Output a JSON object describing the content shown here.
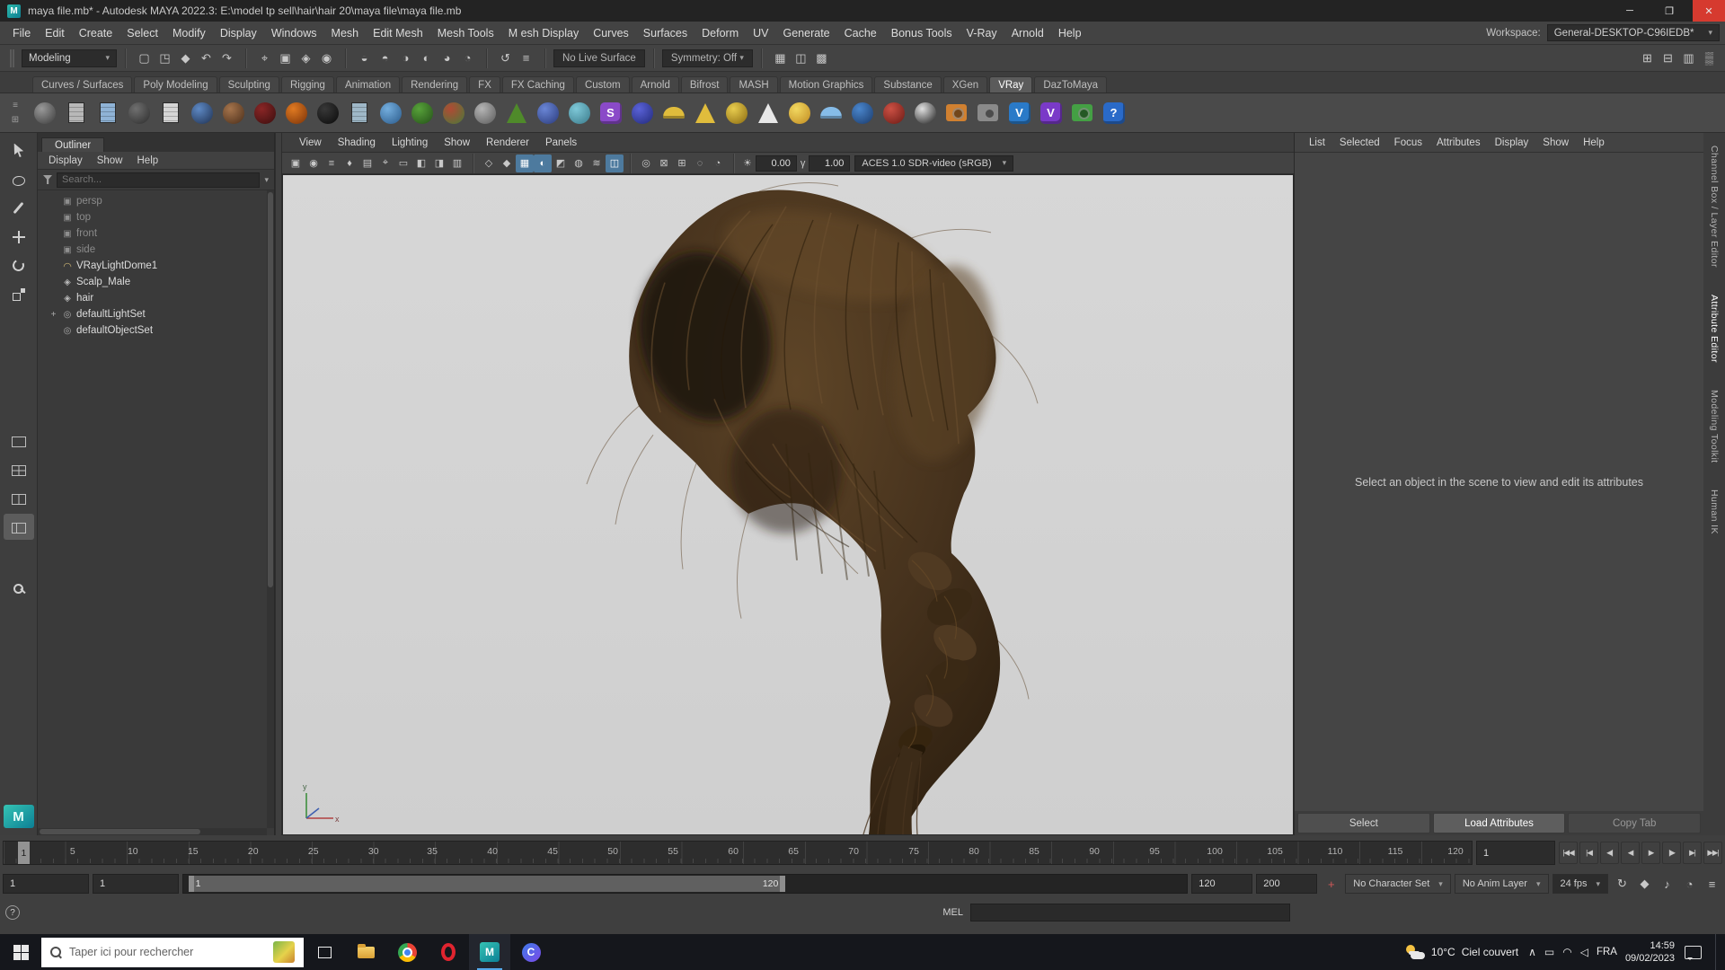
{
  "ui": {
    "caret": "▾"
  },
  "window": {
    "app_badge": "M",
    "title": "maya file.mb* - Autodesk MAYA 2022.3: E:\\model tp sell\\hair\\hair 20\\maya file\\maya file.mb",
    "minimize": "─",
    "maximize": "❐",
    "close": "✕"
  },
  "menubar": {
    "items": [
      "File",
      "Edit",
      "Create",
      "Select",
      "Modify",
      "Display",
      "Windows",
      "Mesh",
      "Edit Mesh",
      "Mesh Tools",
      "M esh Display",
      "Curves",
      "Surfaces",
      "Deform",
      "UV",
      "Generate",
      "Cache",
      "Bonus Tools",
      "V-Ray",
      "Arnold",
      "Help"
    ],
    "workspace_label": "Workspace:",
    "workspace_value": "General-DESKTOP-C96IEDB*"
  },
  "toolbar": {
    "mode": "Modeling",
    "no_live_surface": "No Live Surface",
    "symmetry": "Symmetry: Off",
    "groups": {
      "file": [
        {
          "g": "▢",
          "k": "new-scene-icon"
        },
        {
          "g": "◳",
          "k": "open-scene-icon"
        },
        {
          "g": "◆",
          "k": "save-scene-icon"
        },
        {
          "g": "↶",
          "k": "undo-icon"
        },
        {
          "g": "↷",
          "k": "redo-icon"
        }
      ],
      "select": [
        {
          "g": "⌖",
          "k": "select-by-hierarchy-icon"
        },
        {
          "g": "▣",
          "k": "select-by-object-icon"
        },
        {
          "g": "◈",
          "k": "select-by-component-icon"
        },
        {
          "g": "◉",
          "k": "highlight-selection-icon"
        }
      ],
      "snap": [
        {
          "g": "◒",
          "k": "snap-to-grids-icon"
        },
        {
          "g": "◓",
          "k": "snap-to-curves-icon"
        },
        {
          "g": "◑",
          "k": "snap-to-points-icon"
        },
        {
          "g": "◐",
          "k": "snap-to-projected-center-icon"
        },
        {
          "g": "◕",
          "k": "snap-to-view-planes-icon"
        },
        {
          "g": "◔",
          "k": "make-live-icon"
        }
      ],
      "history": [
        {
          "g": "↺",
          "k": "construction-history-icon"
        },
        {
          "g": "≡",
          "k": "list-input-operations-icon"
        }
      ],
      "render": [
        {
          "g": "▦",
          "k": "render-current-frame-icon"
        },
        {
          "g": "◫",
          "k": "ipr-render-icon"
        },
        {
          "g": "▩",
          "k": "render-settings-icon"
        }
      ],
      "right": [
        {
          "g": "⊞",
          "k": "grid-display-icon"
        },
        {
          "g": "⊟",
          "k": "layout-options-icon"
        },
        {
          "g": "▥",
          "k": "panel-options-icon"
        },
        {
          "g": "▒",
          "k": "texture-display-icon"
        }
      ]
    }
  },
  "shelf": {
    "side_icons": [
      {
        "g": "≡",
        "k": "shelf-tab-menu-icon"
      },
      {
        "g": "⊞",
        "k": "shelf-options-icon"
      }
    ],
    "tabs": [
      {
        "label": "Curves / Surfaces"
      },
      {
        "label": "Poly Modeling"
      },
      {
        "label": "Sculpting"
      },
      {
        "label": "Rigging"
      },
      {
        "label": "Animation"
      },
      {
        "label": "Rendering"
      },
      {
        "label": "FX"
      },
      {
        "label": "FX Caching"
      },
      {
        "label": "Custom"
      },
      {
        "label": "Arnold"
      },
      {
        "label": "Bifrost"
      },
      {
        "label": "MASH"
      },
      {
        "label": "Motion Graphics"
      },
      {
        "label": "Substance"
      },
      {
        "label": "XGen"
      },
      {
        "label": "VRay",
        "active": true
      },
      {
        "label": "DazToMaya"
      }
    ],
    "icons": [
      {
        "k": "vray-material-icon",
        "type": "sphere",
        "c1": "#9a9a9a",
        "c2": "#3a3a3a"
      },
      {
        "k": "vray-mtl-page-icon",
        "type": "page",
        "c1": "#b8b8b8"
      },
      {
        "k": "vray-grid-page-icon",
        "type": "page",
        "c1": "#8fb3d6"
      },
      {
        "k": "vray-blend-mtl-icon",
        "type": "sphere",
        "c1": "#707070",
        "c2": "#2c2c2c"
      },
      {
        "k": "vray-notes-icon",
        "type": "page",
        "c1": "#d6d6d6"
      },
      {
        "k": "vray-chrome-ball-icon",
        "type": "sphere",
        "c1": "#5e89c4",
        "c2": "#1e3050"
      },
      {
        "k": "vray-skin-mtl-icon",
        "type": "sphere",
        "c1": "#a5744c",
        "c2": "#4a2e1a"
      },
      {
        "k": "vray-velvet-mtl-icon",
        "type": "sphere",
        "c1": "#8a2626",
        "c2": "#3a0e0e"
      },
      {
        "k": "vray-fire-mtl-icon",
        "type": "sphere",
        "c1": "#e07a22",
        "c2": "#7a3208"
      },
      {
        "k": "vray-carpaint-mtl-icon",
        "type": "sphere",
        "c1": "#383838",
        "c2": "#0a0a0a"
      },
      {
        "k": "vray-xray-page-icon",
        "type": "page",
        "c1": "#9fb8c8"
      },
      {
        "k": "vray-water-mtl-icon",
        "type": "sphere",
        "c1": "#74aede",
        "c2": "#2a5a8a"
      },
      {
        "k": "vray-emissive-mtl-icon",
        "type": "sphere",
        "c1": "#57a23a",
        "c2": "#245018"
      },
      {
        "k": "vray-plaid-mtl-icon",
        "type": "sphere",
        "c1": "#b04a34",
        "c2": "#4a7a3a"
      },
      {
        "k": "vray-subsurface-mtl-icon",
        "type": "sphere",
        "c1": "#b5b5b5",
        "c2": "#5a5a5a"
      },
      {
        "k": "vray-fur-grass-icon",
        "type": "cone",
        "c1": "#4f8a2a"
      },
      {
        "k": "vray-scatter-icon",
        "type": "sphere",
        "c1": "#6a86d6",
        "c2": "#2a3a7a"
      },
      {
        "k": "vray-snow-icon",
        "type": "sphere",
        "c1": "#7ec8d8",
        "c2": "#3a7a8a"
      },
      {
        "k": "vray-stochastic-icon",
        "type": "letter",
        "c1": "#8a4ac8",
        "label": "S"
      },
      {
        "k": "vray-mtl-ball-icon",
        "type": "sphere",
        "c1": "#5a62d8",
        "c2": "#222a7a"
      },
      {
        "k": "vray-dome-light-icon",
        "type": "dome",
        "c1": "#e0bc3c"
      },
      {
        "k": "vray-spot-light-icon",
        "type": "cone",
        "c1": "#e0bc3c"
      },
      {
        "k": "vray-sphere-light-icon",
        "type": "sphere",
        "c1": "#e8cc4e",
        "c2": "#8a6a10"
      },
      {
        "k": "vray-ies-light-icon",
        "type": "cone",
        "c1": "#e8e8e8"
      },
      {
        "k": "vray-sun-icon",
        "type": "sphere",
        "c1": "#f2d860",
        "c2": "#c08a20"
      },
      {
        "k": "vray-sky-icon",
        "type": "dome",
        "c1": "#86bce8"
      },
      {
        "k": "vray-light-dome-icon",
        "type": "sphere",
        "c1": "#4a86cc",
        "c2": "#1a3a6a"
      },
      {
        "k": "vray-light-mesh-icon",
        "type": "sphere",
        "c1": "#cc5044",
        "c2": "#6a1a14"
      },
      {
        "k": "vray-checker-icon",
        "type": "sphere",
        "c1": "#e0e0e0",
        "c2": "#1a1a1a"
      },
      {
        "k": "vray-physical-camera-icon",
        "type": "square",
        "c1": "#d08030"
      },
      {
        "k": "vray-camera-icon",
        "type": "square",
        "c1": "#8a8a8a"
      },
      {
        "k": "vray-render-icon",
        "type": "letter",
        "c1": "#2a7ac8",
        "label": "V"
      },
      {
        "k": "vray-ipr-icon",
        "type": "letter",
        "c1": "#7a3ac8",
        "label": "V"
      },
      {
        "k": "vray-rgb-icon",
        "type": "square",
        "c1": "#44a044"
      },
      {
        "k": "vray-help-icon",
        "type": "letter",
        "c1": "#2a6ac8",
        "label": "?"
      }
    ]
  },
  "toolbox": {
    "logo": "M",
    "tools": [
      {
        "k": "select-tool"
      },
      {
        "k": "lasso-tool"
      },
      {
        "k": "paint-select-tool"
      },
      {
        "k": "move-tool"
      },
      {
        "k": "rotate-tool"
      },
      {
        "k": "scale-tool"
      }
    ],
    "layouts": [
      {
        "k": "layout-single"
      },
      {
        "k": "layout-four"
      },
      {
        "k": "layout-two"
      },
      {
        "k": "layout-outliner",
        "active": true
      }
    ],
    "zoom": [
      {
        "k": "zoom-tool"
      }
    ]
  },
  "outliner": {
    "title": "Outliner",
    "menus": [
      "Display",
      "Show",
      "Help"
    ],
    "search_placeholder": "Search...",
    "items": [
      {
        "label": "persp",
        "type": "camera",
        "dim": true,
        "exp": ""
      },
      {
        "label": "top",
        "type": "camera",
        "dim": true,
        "exp": ""
      },
      {
        "label": "front",
        "type": "camera",
        "dim": true,
        "exp": ""
      },
      {
        "label": "side",
        "type": "camera",
        "dim": true,
        "exp": ""
      },
      {
        "label": "VRayLightDome1",
        "type": "light",
        "exp": ""
      },
      {
        "label": "Scalp_Male",
        "type": "mesh",
        "exp": ""
      },
      {
        "label": "hair",
        "type": "mesh",
        "exp": ""
      },
      {
        "label": "defaultLightSet",
        "type": "set",
        "exp": "+"
      },
      {
        "label": "defaultObjectSet",
        "type": "set",
        "exp": ""
      }
    ]
  },
  "vp": {
    "menus": [
      "View",
      "Shading",
      "Lighting",
      "Show",
      "Renderer",
      "Panels"
    ],
    "icons_a": [
      {
        "g": "▣",
        "k": "select-camera-icon"
      },
      {
        "g": "◉",
        "k": "lock-camera-icon"
      },
      {
        "g": "≡",
        "k": "camera-attributes-icon"
      },
      {
        "g": "♦",
        "k": "bookmark-icon"
      },
      {
        "g": "▤",
        "k": "image-plane-icon"
      },
      {
        "g": "⌖",
        "k": "pan-zoom-icon"
      },
      {
        "g": "▭",
        "k": "film-gate-icon"
      },
      {
        "g": "◧",
        "k": "resolution-gate-icon"
      },
      {
        "g": "◨",
        "k": "gate-mask-icon"
      },
      {
        "g": "▥",
        "k": "field-chart-icon"
      }
    ],
    "icons_b": [
      {
        "g": "◇",
        "k": "wireframe-icon"
      },
      {
        "g": "◆",
        "k": "smooth-shade-icon"
      },
      {
        "g": "▦",
        "k": "textured-icon",
        "active": true
      },
      {
        "g": "◐",
        "k": "use-all-lights-icon",
        "active": true
      },
      {
        "g": "◩",
        "k": "shadows-icon"
      },
      {
        "g": "◍",
        "k": "screen-space-ao-icon"
      },
      {
        "g": "≋",
        "k": "motion-blur-icon"
      },
      {
        "g": "◫",
        "k": "multisample-aa-icon",
        "active": true
      }
    ],
    "icons_c": [
      {
        "g": "◎",
        "k": "isolate-select-icon"
      },
      {
        "g": "⊠",
        "k": "xray-icon"
      },
      {
        "g": "⊞",
        "k": "grid-toggle-icon"
      },
      {
        "g": "◌",
        "k": "film-fit-icon"
      },
      {
        "g": "◔",
        "k": "fog-icon"
      }
    ],
    "exposure_icon": "☀",
    "exposure": "0.00",
    "gamma_icon": "γ",
    "gamma": "1.00",
    "colorspace": "ACES 1.0 SDR-video (sRGB)"
  },
  "viewport_axis": {
    "x_label": "x",
    "y_label": "y"
  },
  "attribute_editor": {
    "menus": [
      "List",
      "Selected",
      "Focus",
      "Attributes",
      "Display",
      "Show",
      "Help"
    ],
    "message": "Select an object in the scene to view and edit its attributes",
    "buttons": [
      {
        "label": "Select"
      },
      {
        "label": "Load Attributes",
        "active": true
      },
      {
        "label": "Copy Tab",
        "dim": true
      }
    ]
  },
  "side_tabs": [
    {
      "label": "Channel Box / Layer Editor"
    },
    {
      "label": "Attribute Editor",
      "active": true
    },
    {
      "label": "Modeling Toolkit"
    },
    {
      "label": "Human IK"
    }
  ],
  "timeline": {
    "current_frame": "1",
    "time_field": "1",
    "labels": [
      {
        "f": 5,
        "x": 4.7
      },
      {
        "f": 10,
        "x": 8.8
      },
      {
        "f": 15,
        "x": 12.9
      },
      {
        "f": 20,
        "x": 17.0
      },
      {
        "f": 25,
        "x": 21.1
      },
      {
        "f": 30,
        "x": 25.2
      },
      {
        "f": 35,
        "x": 29.2
      },
      {
        "f": 40,
        "x": 33.3
      },
      {
        "f": 45,
        "x": 37.4
      },
      {
        "f": 50,
        "x": 41.5
      },
      {
        "f": 55,
        "x": 45.6
      },
      {
        "f": 60,
        "x": 49.7
      },
      {
        "f": 65,
        "x": 53.8
      },
      {
        "f": 70,
        "x": 57.9
      },
      {
        "f": 75,
        "x": 62.0
      },
      {
        "f": 80,
        "x": 66.1
      },
      {
        "f": 85,
        "x": 70.2
      },
      {
        "f": 90,
        "x": 74.3
      },
      {
        "f": 95,
        "x": 78.4
      },
      {
        "f": 100,
        "x": 82.5
      },
      {
        "f": 105,
        "x": 86.6
      },
      {
        "f": 110,
        "x": 90.7
      },
      {
        "f": 115,
        "x": 94.8
      },
      {
        "f": 120,
        "x": 98.9
      }
    ],
    "playback": [
      {
        "g": "|◀◀",
        "k": "go-to-start-button"
      },
      {
        "g": "|◀",
        "k": "step-back-frame-button"
      },
      {
        "g": "◀|",
        "k": "step-back-key-button"
      },
      {
        "g": "◀",
        "k": "play-backwards-button"
      },
      {
        "g": "▶",
        "k": "play-forwards-button"
      },
      {
        "g": "|▶",
        "k": "step-forward-key-button"
      },
      {
        "g": "▶|",
        "k": "step-forward-frame-button"
      },
      {
        "g": "▶▶|",
        "k": "go-to-end-button"
      }
    ]
  },
  "range": {
    "anim_start": "1",
    "playback_start": "1",
    "bar_start_label": "1",
    "bar_end_label": "120",
    "playback_end": "120",
    "anim_end": "200",
    "key_icons": [
      {
        "g": "+",
        "k": "set-key-icon",
        "c1": "#d05858"
      }
    ],
    "character_set": "No Character Set",
    "anim_layer": "No Anim Layer",
    "fps": "24 fps",
    "icons": [
      {
        "g": "↻",
        "k": "playback-speed-icon"
      },
      {
        "g": "◆",
        "k": "auto-keyframe-icon"
      },
      {
        "g": "♪",
        "k": "mute-icon"
      },
      {
        "g": "◔",
        "k": "cached-playback-icon"
      },
      {
        "g": "≡",
        "k": "animation-preferences-icon"
      }
    ]
  },
  "command_line": {
    "help_icon": "?",
    "mel_label": "MEL"
  },
  "taskbar": {
    "search_placeholder": "Taper ici pour rechercher",
    "apps": [
      {
        "k": "task-view-icon",
        "label": ""
      },
      {
        "k": "file-explorer-icon",
        "label": ""
      },
      {
        "k": "chrome-icon",
        "label": ""
      },
      {
        "k": "opera-icon",
        "label": ""
      },
      {
        "k": "maya-app-icon",
        "label": "M",
        "active": true
      },
      {
        "k": "clipchamp-icon",
        "label": "C"
      }
    ],
    "weather_temp": "10°C",
    "weather_desc": "Ciel couvert",
    "tray_chevron": "∧",
    "tray_icons": [
      {
        "g": "▭",
        "k": "display-tray-icon"
      },
      {
        "g": "◠",
        "k": "network-tray-icon"
      },
      {
        "g": "◁",
        "k": "volume-tray-icon"
      }
    ],
    "lang": "FRA",
    "time": "14:59",
    "date": "09/02/2023"
  }
}
